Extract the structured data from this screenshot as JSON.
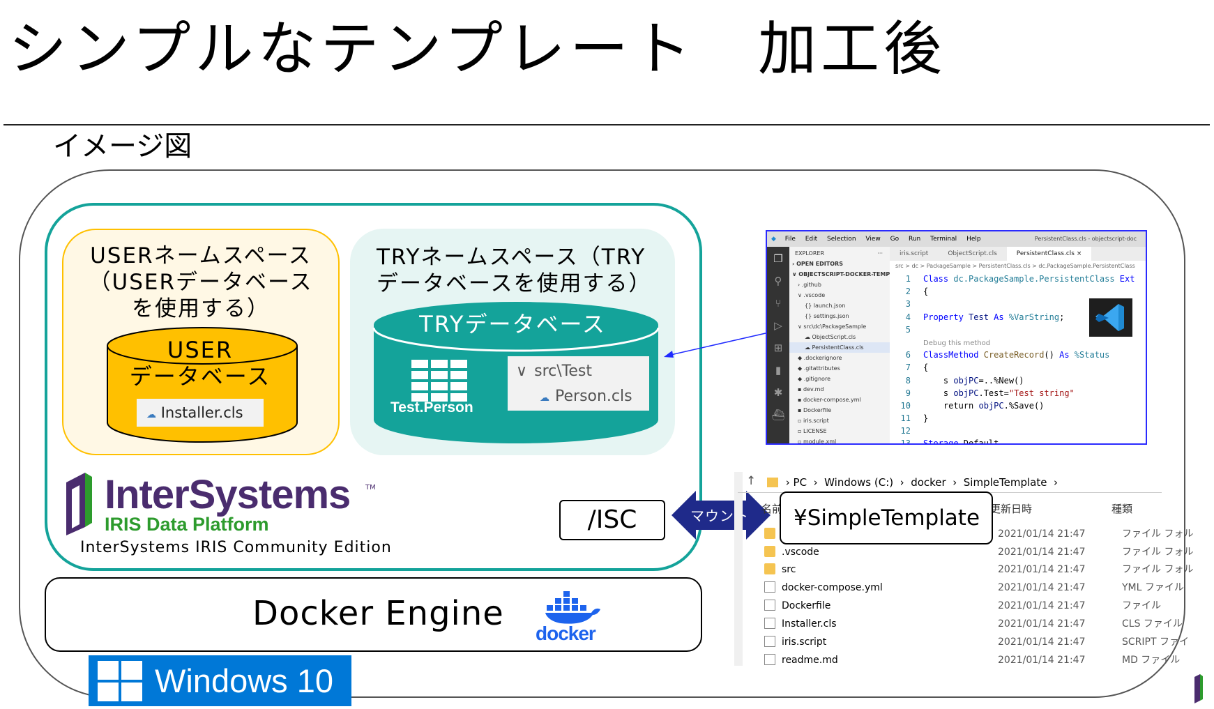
{
  "slide": {
    "title": "シンプルなテンプレート　加工後",
    "subtitle": "イメージ図"
  },
  "iris": {
    "user_namespace_label": "USERネームスペース（USERデータベースを使用する）",
    "user_db_label": "USER\nデータベース",
    "user_db_file": "Installer.cls",
    "try_namespace_label": "TRYネームスペース（TRYデータベースを使用する）",
    "try_db_label": "TRYデータベース",
    "try_table": "Test.Person",
    "try_folder": "src\\Test",
    "try_file": "Person.cls",
    "brand": "InterSystems",
    "tm": "TM",
    "product": "IRIS Data Platform",
    "edition": "InterSystems IRIS Community Edition",
    "mount_path": "/ISC"
  },
  "docker": {
    "engine_label": "Docker Engine",
    "wordmark": "docker"
  },
  "windows": {
    "label": "Windows 10"
  },
  "mount": {
    "label": "マウント",
    "host_path": "¥SimpleTemplate"
  },
  "vscode": {
    "menu": [
      "File",
      "Edit",
      "Selection",
      "View",
      "Go",
      "Run",
      "Terminal",
      "Help"
    ],
    "window_title": "PersistentClass.cls - objectscript-doc",
    "explorer_title": "EXPLORER",
    "open_editors": "OPEN EDITORS",
    "workspace": "OBJECTSCRIPT-DOCKER-TEMPLATE",
    "tree": [
      ".github",
      ".vscode",
      "launch.json",
      "settings.json",
      "src\\dc\\PackageSample",
      "ObjectScript.cls",
      "PersistentClass.cls",
      ".dockerignore",
      ".gitattributes",
      ".gitignore",
      "dev.md",
      "docker-compose.yml",
      "Dockerfile",
      "iris.script",
      "LICENSE",
      "module.xml"
    ],
    "tabs": [
      "iris.script",
      "ObjectScript.cls",
      "PersistentClass.cls ×"
    ],
    "breadcrumb": "src > dc > PackageSample > PersistentClass.cls > dc.PackageSample.PersistentClass",
    "code_lines": [
      {
        "n": "1",
        "t": "Class dc.PackageSample.PersistentClass Ext"
      },
      {
        "n": "2",
        "t": "{"
      },
      {
        "n": "3",
        "t": ""
      },
      {
        "n": "4",
        "t": "Property Test As %VarString;"
      },
      {
        "n": "5",
        "t": ""
      },
      {
        "n": "",
        "t": "Debug this method"
      },
      {
        "n": "6",
        "t": "ClassMethod CreateRecord() As %Status"
      },
      {
        "n": "7",
        "t": "{"
      },
      {
        "n": "8",
        "t": "    s objPC=..%New()"
      },
      {
        "n": "9",
        "t": "    s objPC.Test=\"Test string\""
      },
      {
        "n": "10",
        "t": "    return objPC.%Save()"
      },
      {
        "n": "11",
        "t": "}"
      },
      {
        "n": "12",
        "t": ""
      },
      {
        "n": "13",
        "t": "Storage Default"
      }
    ]
  },
  "explorer": {
    "path": [
      "PC",
      "Windows (C:)",
      "docker",
      "SimpleTemplate"
    ],
    "col_name": "名前",
    "col_date": "更新日時",
    "col_type": "種類",
    "rows": [
      {
        "name": "",
        "date": "2021/01/14 21:47",
        "type": "ファイル フォル",
        "kind": "folder"
      },
      {
        "name": ".vscode",
        "date": "2021/01/14 21:47",
        "type": "ファイル フォル",
        "kind": "folder"
      },
      {
        "name": "src",
        "date": "2021/01/14 21:47",
        "type": "ファイル フォル",
        "kind": "folder"
      },
      {
        "name": "docker-compose.yml",
        "date": "2021/01/14 21:47",
        "type": "YML ファイル",
        "kind": "file"
      },
      {
        "name": "Dockerfile",
        "date": "2021/01/14 21:47",
        "type": "ファイル",
        "kind": "file"
      },
      {
        "name": "Installer.cls",
        "date": "2021/01/14 21:47",
        "type": "CLS ファイル",
        "kind": "file"
      },
      {
        "name": "iris.script",
        "date": "2021/01/14 21:47",
        "type": "SCRIPT ファイ",
        "kind": "file"
      },
      {
        "name": "readme.md",
        "date": "2021/01/14 21:47",
        "type": "MD ファイル",
        "kind": "file"
      }
    ]
  },
  "colors": {
    "teal": "#14a39a",
    "gold": "#ffc000",
    "purple": "#4a2c6e",
    "green": "#2d9b2d",
    "docker_blue": "#1d63ed",
    "windows_blue": "#0078d7",
    "arrow_navy": "#1f2a8a"
  }
}
